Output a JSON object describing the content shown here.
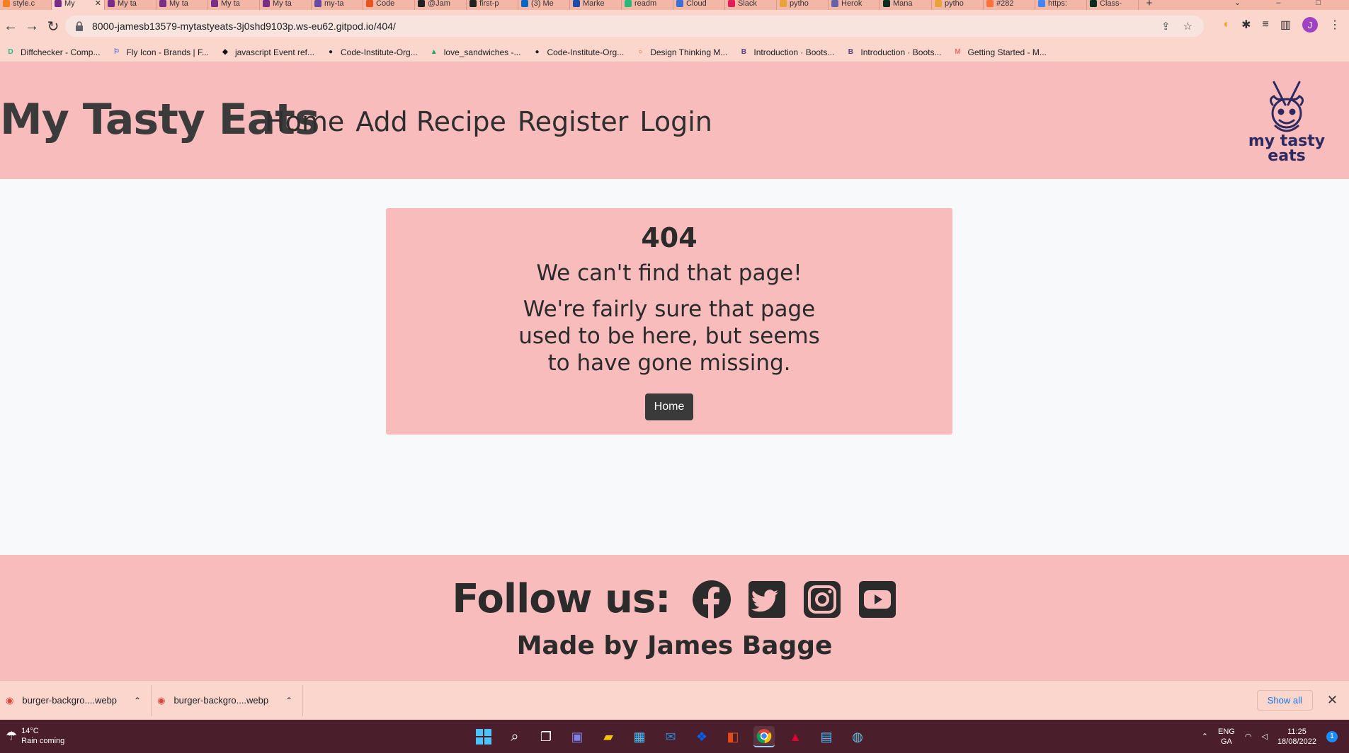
{
  "browser": {
    "tabs": [
      {
        "label": "style.c",
        "color": "#f48024"
      },
      {
        "label": "My",
        "color": "#7a2d86",
        "active": true
      },
      {
        "label": "My ta",
        "color": "#7a2d86"
      },
      {
        "label": "My ta",
        "color": "#7a2d86"
      },
      {
        "label": "My ta",
        "color": "#7a2d86"
      },
      {
        "label": "My ta",
        "color": "#7a2d86"
      },
      {
        "label": "my-ta",
        "color": "#6a4aa0"
      },
      {
        "label": "Code",
        "color": "#e8541c"
      },
      {
        "label": "@Jam",
        "color": "#222222"
      },
      {
        "label": "first-p",
        "color": "#222222"
      },
      {
        "label": "(3) Me",
        "color": "#0a66c2"
      },
      {
        "label": "Marke",
        "color": "#1f4aa8"
      },
      {
        "label": "readm",
        "color": "#2db67c"
      },
      {
        "label": "Cloud",
        "color": "#3c6fd8"
      },
      {
        "label": "Slack",
        "color": "#e01e5a"
      },
      {
        "label": "pytho",
        "color": "#e8a33a"
      },
      {
        "label": "Herok",
        "color": "#6762a6"
      },
      {
        "label": "Mana",
        "color": "#092e20"
      },
      {
        "label": "pytho",
        "color": "#e8a33a"
      },
      {
        "label": "#282",
        "color": "#ff7139"
      },
      {
        "label": "https:",
        "color": "#4285f4"
      },
      {
        "label": "Class-",
        "color": "#092e20"
      }
    ],
    "url": "8000-jamesb13579-mytastyeats-3j0shd9103p.ws-eu62.gitpod.io/404/",
    "bookmarks": [
      {
        "label": "Diffchecker - Comp...",
        "icon": "diffchecker-icon",
        "glyph": "D",
        "color": "#2db67c"
      },
      {
        "label": "Fly Icon - Brands | F...",
        "icon": "flag-icon",
        "glyph": "⚐",
        "color": "#3b5bdb"
      },
      {
        "label": "javascript Event ref...",
        "icon": "code-icon",
        "glyph": "◆",
        "color": "#111111"
      },
      {
        "label": "Code-Institute-Org...",
        "icon": "github-icon",
        "glyph": "●",
        "color": "#222222"
      },
      {
        "label": "love_sandwiches -...",
        "icon": "drive-icon",
        "glyph": "▲",
        "color": "#1fa463"
      },
      {
        "label": "Code-Institute-Org...",
        "icon": "github-icon",
        "glyph": "●",
        "color": "#222222"
      },
      {
        "label": "Design Thinking M...",
        "icon": "circle-icon",
        "glyph": "○",
        "color": "#e8541c"
      },
      {
        "label": "Introduction · Boots...",
        "icon": "bootstrap-icon",
        "glyph": "B",
        "color": "#563d7c"
      },
      {
        "label": "Introduction · Boots...",
        "icon": "bootstrap-icon",
        "glyph": "B",
        "color": "#563d7c"
      },
      {
        "label": "Getting Started - M...",
        "icon": "materialize-icon",
        "glyph": "M",
        "color": "#ee6e73"
      }
    ],
    "avatar_initial": "J"
  },
  "site": {
    "brand": "My Tasty Eats",
    "nav": [
      "Home",
      "Add Recipe",
      "Register",
      "Login"
    ],
    "logo_text_line1": "my tasty",
    "logo_text_line2": "eats"
  },
  "error_card": {
    "code": "404",
    "heading": "We can't find that page!",
    "message": "We're fairly sure that page used to be here, but seems to have gone missing.",
    "button": "Home"
  },
  "footer": {
    "follow_label": "Follow us:",
    "socials": [
      "facebook-icon",
      "twitter-icon",
      "instagram-icon",
      "youtube-icon"
    ],
    "credit": "Made by James Bagge"
  },
  "downloads": {
    "items": [
      "burger-backgro....webp",
      "burger-backgro....webp"
    ],
    "show_all": "Show all"
  },
  "taskbar": {
    "temperature": "14°C",
    "weather": "Rain coming",
    "lang_line1": "ENG",
    "lang_line2": "GA",
    "time": "11:25",
    "date": "18/08/2022",
    "notifications": "1"
  },
  "colors": {
    "header_bg": "#f8bcbc",
    "page_bg": "#f8f9fa",
    "button_bg": "#3a3a3a",
    "logo_ink": "#2c2a5e"
  }
}
